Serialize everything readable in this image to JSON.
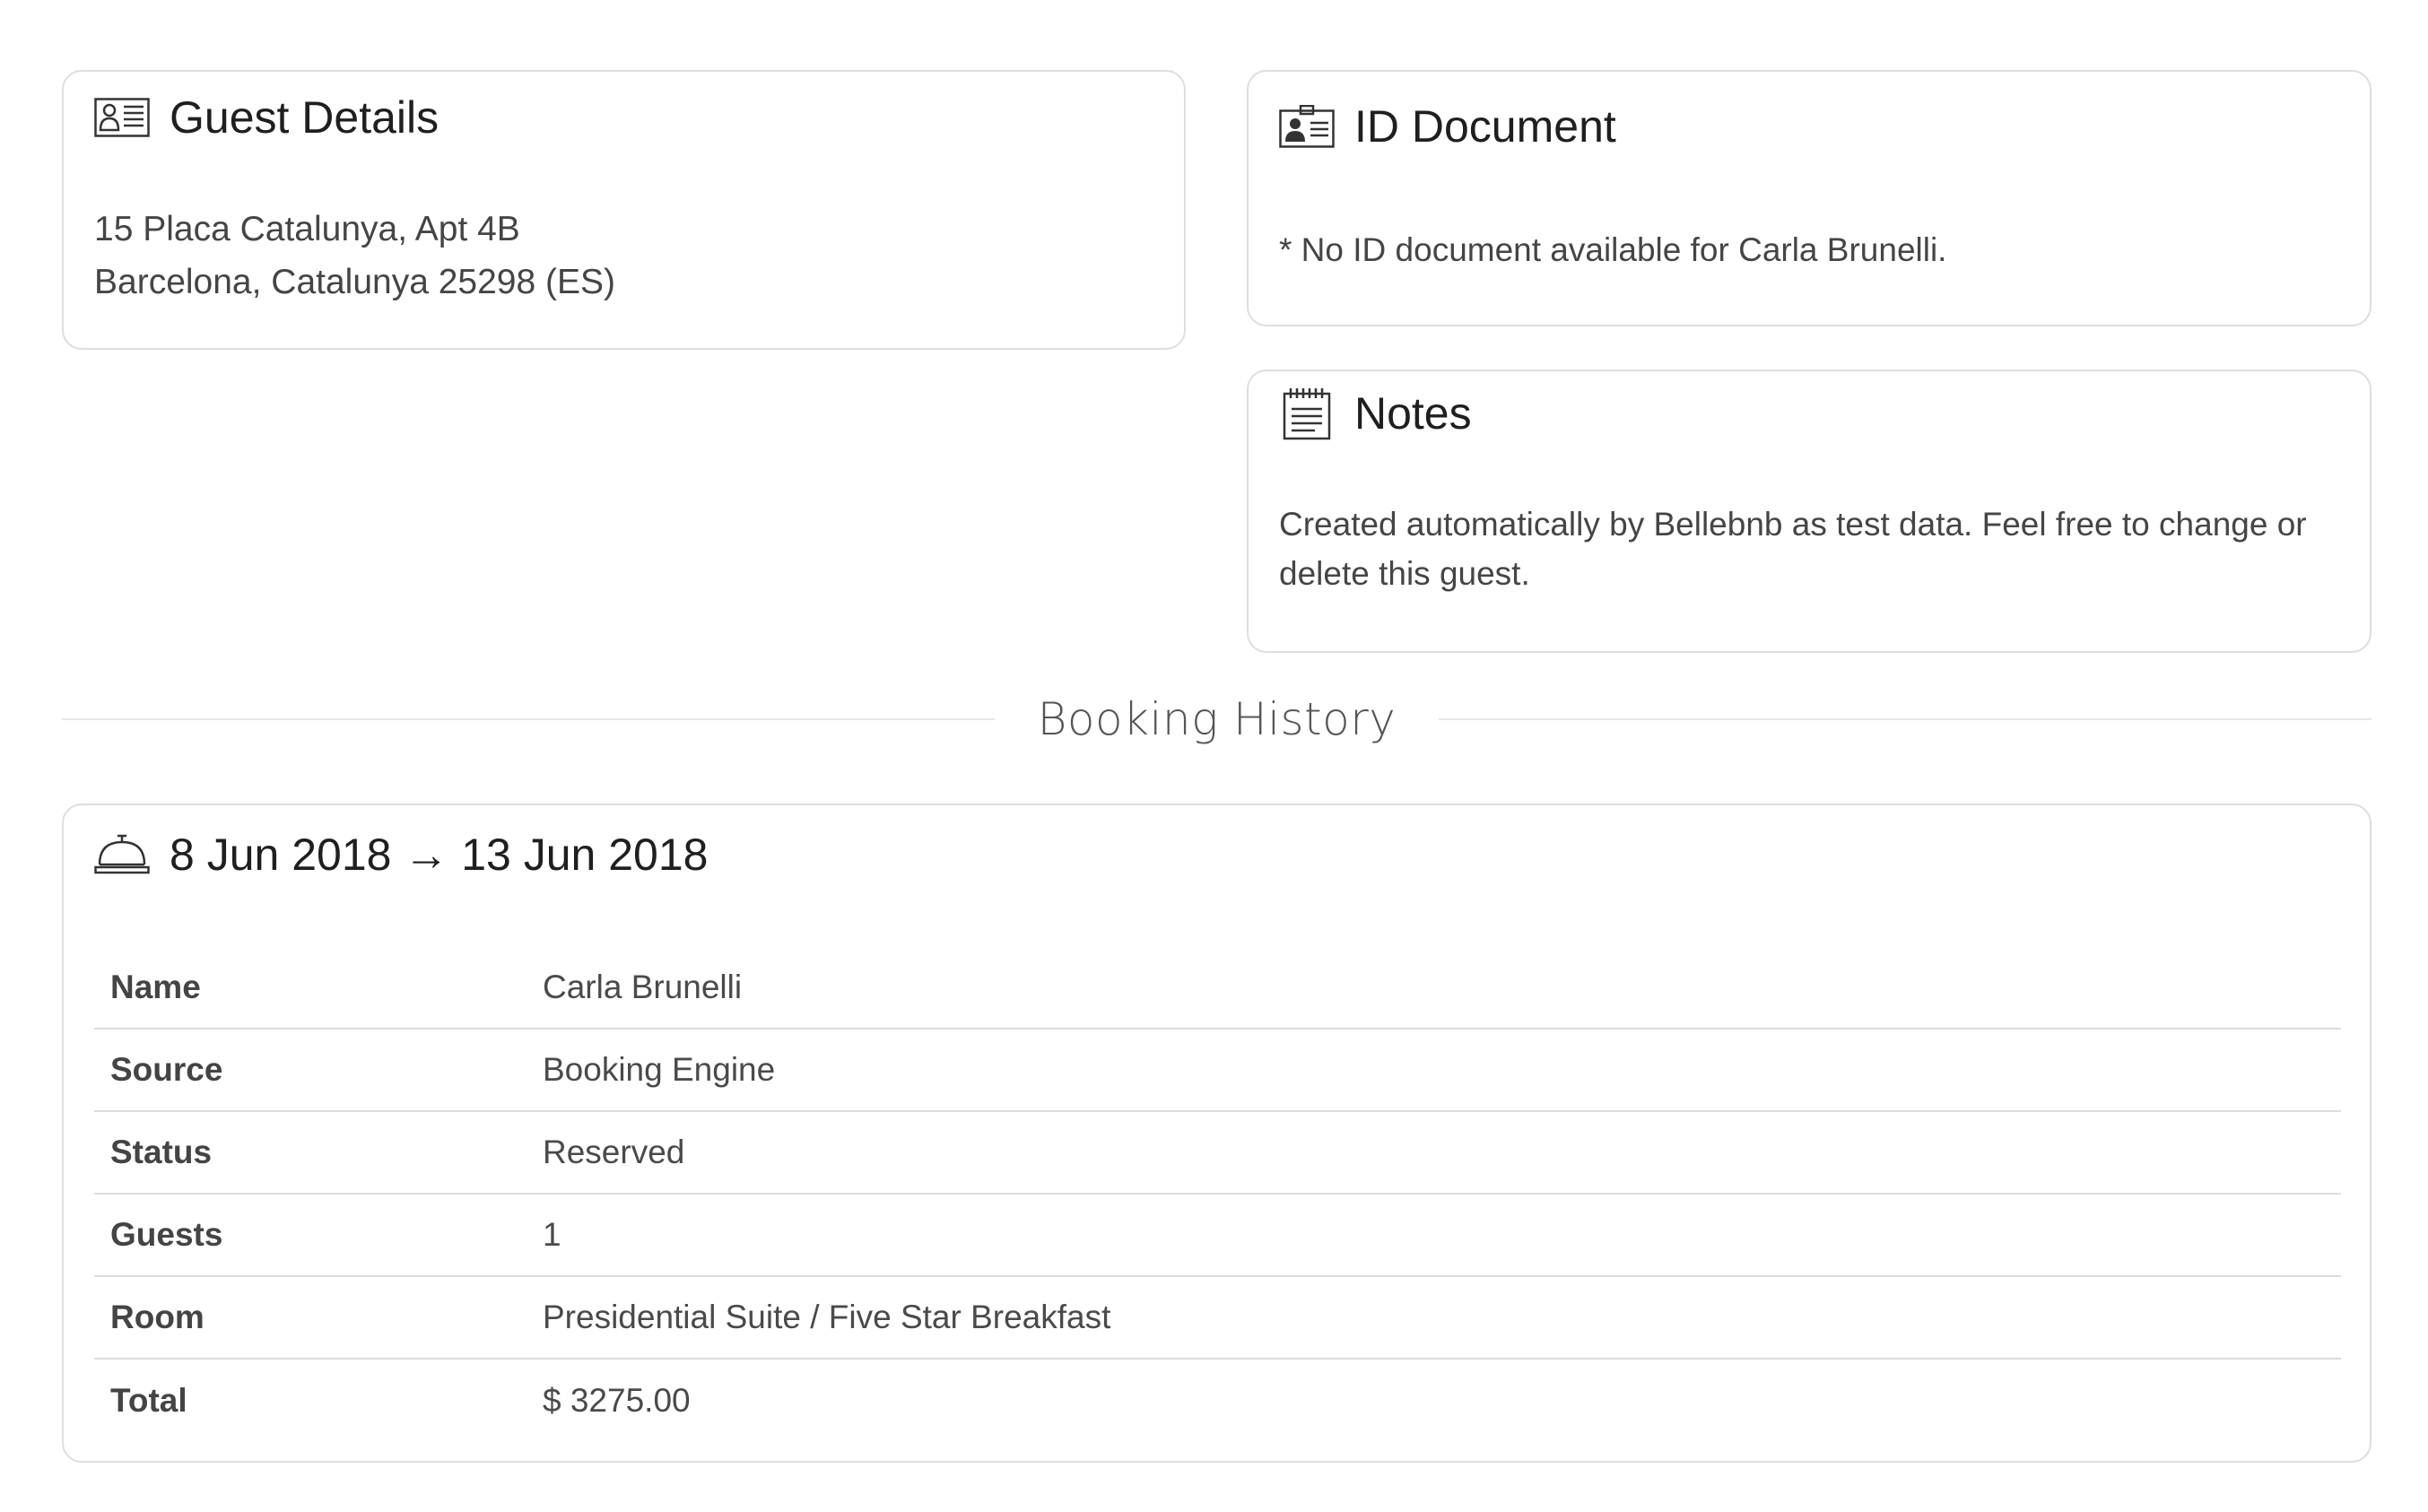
{
  "guest_details": {
    "title": "Guest Details",
    "icon": "contact-card-icon",
    "address_line1": "15 Placa Catalunya, Apt 4B",
    "address_line2": "Barcelona, Catalunya 25298 (ES)"
  },
  "id_document": {
    "title": "ID Document",
    "icon": "id-badge-icon",
    "message": "* No ID document available for Carla Brunelli."
  },
  "notes": {
    "title": "Notes",
    "icon": "notepad-icon",
    "text_line1": "Created automatically by Bellebnb as test data. Feel free to change or",
    "text_line2": "delete this guest."
  },
  "booking_history": {
    "heading": "Booking History",
    "bookings": [
      {
        "icon": "service-bell-icon",
        "date_range": "8 Jun 2018 → 13 Jun 2018",
        "rows": [
          {
            "label": "Name",
            "value": "Carla Brunelli"
          },
          {
            "label": "Source",
            "value": "Booking Engine"
          },
          {
            "label": "Status",
            "value": "Reserved"
          },
          {
            "label": "Guests",
            "value": "1"
          },
          {
            "label": "Room",
            "value": "Presidential Suite / Five Star Breakfast"
          },
          {
            "label": "Total",
            "value": "$ 3275.00"
          }
        ]
      }
    ]
  }
}
